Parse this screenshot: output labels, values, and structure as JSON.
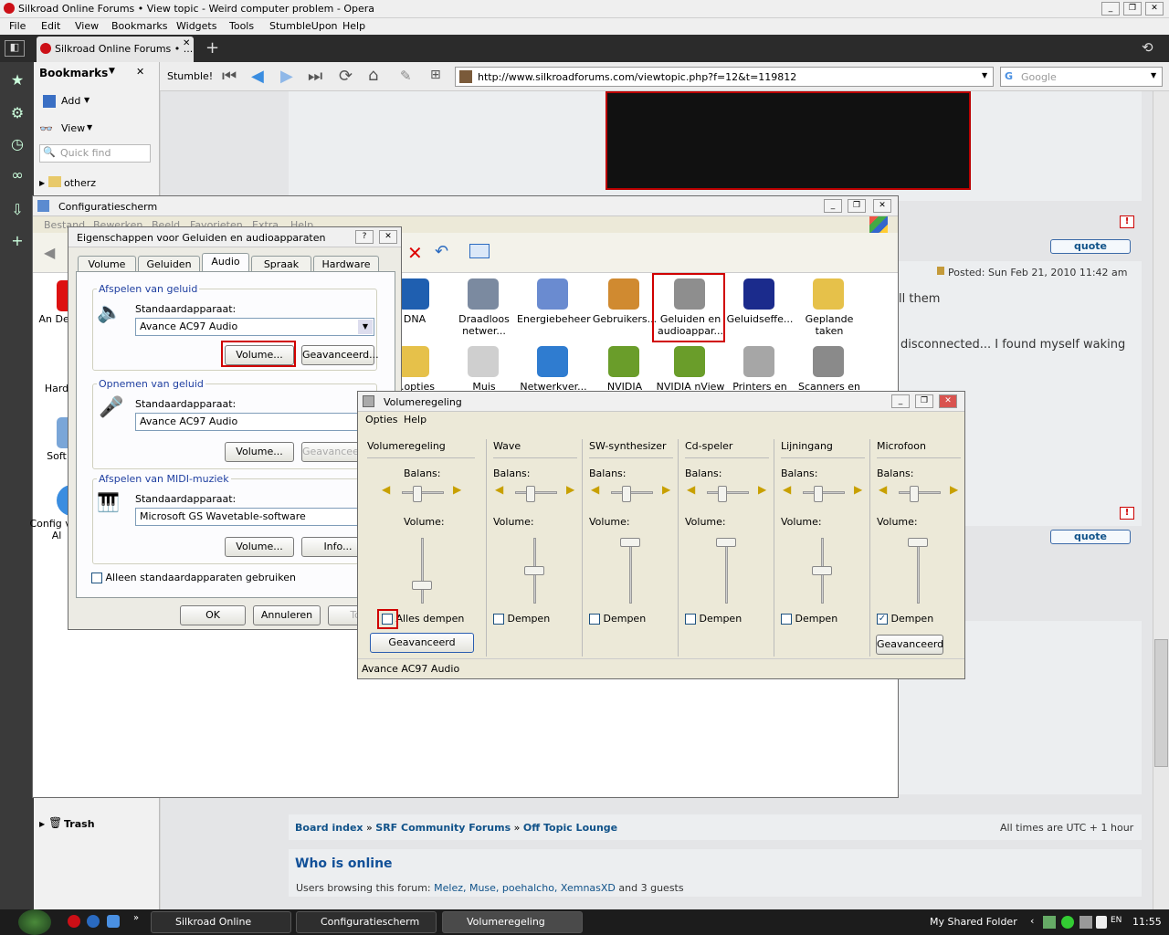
{
  "browser": {
    "title": "Silkroad Online Forums • View topic - Weird computer problem - Opera",
    "menu": [
      "File",
      "Edit",
      "View",
      "Bookmarks",
      "Widgets",
      "Tools",
      "StumbleUpon",
      "Help"
    ],
    "tab_label": "Silkroad Online Forums • ...",
    "stumble_label": "Stumble!",
    "url": "http://www.silkroadforums.com/viewtopic.php?f=12&t=119812",
    "search_placeholder": "Google"
  },
  "bookmarks": {
    "title": "Bookmarks",
    "add": "Add",
    "view": "View",
    "quickfind": "Quick find",
    "folder": "otherz",
    "trash": "Trash"
  },
  "forum": {
    "quote": "quote",
    "posted": "Posted: Sun Feb 21, 2010 11:42 am",
    "text1": "ll them",
    "text2": "disconnected... I found myself waking",
    "breadcrumb": [
      "Board index",
      "SRF Community Forums",
      "Off Topic Lounge"
    ],
    "timezone": "All times are UTC + 1 hour",
    "who_title": "Who is online",
    "browsing": "Users browsing this forum:",
    "users": "Melez, Muse, poehalcho, XemnasXD",
    "guests": "and 3 guests"
  },
  "cp": {
    "title": "Configuratiescherm",
    "menu": [
      "Bestand",
      "Bewerken",
      "Beeld",
      "Favorieten",
      "Extra",
      "Help"
    ],
    "icons": [
      {
        "label": "DNA",
        "color": "#1f5fb0"
      },
      {
        "label": "Draadloos netwer...",
        "color": "#7b8aa0"
      },
      {
        "label": "Energiebeheer",
        "color": "#6a8bd0"
      },
      {
        "label": "Gebruikers...",
        "color": "#d08a30"
      },
      {
        "label": "Geluiden en audioappar...",
        "color": "#8e8e8e"
      },
      {
        "label": "Geluidseffe...",
        "color": "#1b2b8c"
      },
      {
        "label": "Geplande taken",
        "color": "#e6c14a"
      },
      {
        "label": "...opties",
        "color": "#e6c14a"
      },
      {
        "label": "Muis",
        "color": "#cfcfcf"
      },
      {
        "label": "Netwerkver...",
        "color": "#2f7cd0"
      },
      {
        "label": "NVIDIA",
        "color": "#6a9d2a"
      },
      {
        "label": "NVIDIA nView",
        "color": "#6a9d2a"
      },
      {
        "label": "Printers en",
        "color": "#a6a6a6"
      },
      {
        "label": "Scanners en",
        "color": "#8a8a8a"
      }
    ],
    "left_labels": [
      "An Des",
      "Hard",
      "Soft",
      "Config van Al"
    ]
  },
  "sound": {
    "title": "Eigenschappen voor Geluiden en audioapparaten",
    "tabs": [
      "Volume",
      "Geluiden",
      "Audio",
      "Spraak",
      "Hardware"
    ],
    "playback": {
      "label": "Afspelen van geluid",
      "std": "Standaardapparaat:",
      "device": "Avance AC97 Audio",
      "volume": "Volume...",
      "advanced": "Geavanceerd..."
    },
    "record": {
      "label": "Opnemen van geluid",
      "std": "Standaardapparaat:",
      "device": "Avance AC97 Audio",
      "volume": "Volume...",
      "advanced": "Geavanceerd..."
    },
    "midi": {
      "label": "Afspelen van MIDI-muziek",
      "std": "Standaardapparaat:",
      "device": "Microsoft GS Wavetable-software",
      "volume": "Volume...",
      "info": "Info..."
    },
    "only_default": "Alleen standaardapparaten gebruiken",
    "ok": "OK",
    "cancel": "Annuleren",
    "apply": "Toep"
  },
  "mixer": {
    "title": "Volumeregeling",
    "menu": [
      "Opties",
      "Help"
    ],
    "balance": "Balans:",
    "volume": "Volume:",
    "advanced": "Geavanceerd",
    "status": "Avance AC97 Audio",
    "channels": [
      {
        "name": "Volumeregeling",
        "mute_label": "Alles dempen",
        "muted": false,
        "level": 0.25
      },
      {
        "name": "Wave",
        "mute_label": "Dempen",
        "muted": false,
        "level": 0.5
      },
      {
        "name": "SW-synthesizer",
        "mute_label": "Dempen",
        "muted": false,
        "level": 1.0
      },
      {
        "name": "Cd-speler",
        "mute_label": "Dempen",
        "muted": false,
        "level": 1.0
      },
      {
        "name": "Lijningang",
        "mute_label": "Dempen",
        "muted": false,
        "level": 0.5
      },
      {
        "name": "Microfoon",
        "mute_label": "Dempen",
        "muted": true,
        "level": 1.0
      }
    ]
  },
  "taskbar": {
    "items": [
      "Silkroad Online Forum...",
      "Configuratiescherm",
      "Volumeregeling"
    ],
    "shared": "My Shared Folder",
    "clock": "11:55",
    "lang": "EN"
  }
}
